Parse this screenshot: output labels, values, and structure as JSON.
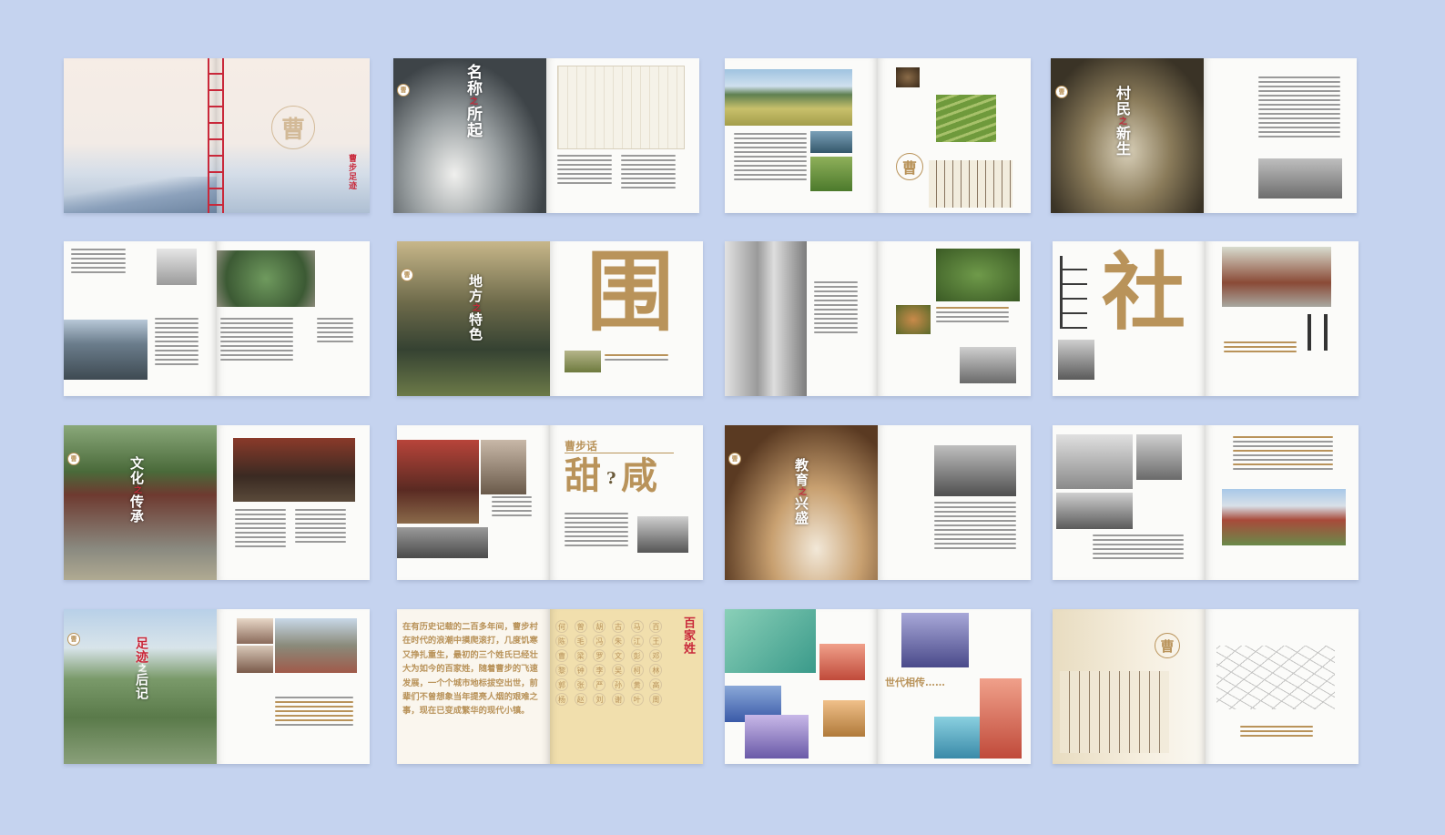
{
  "spreads": [
    {
      "id": 1,
      "title": "曹步足迹",
      "logo": "曹"
    },
    {
      "id": 2,
      "title_main": "名称",
      "title_join": "之",
      "title_end": "所起"
    },
    {
      "id": 3,
      "logo": "曹"
    },
    {
      "id": 4,
      "title_main": "村民",
      "title_join": "之",
      "title_end": "新生"
    },
    {
      "id": 5
    },
    {
      "id": 6,
      "title_main": "地方",
      "title_join": "之",
      "title_end": "特色",
      "big_char": "围"
    },
    {
      "id": 7
    },
    {
      "id": 8,
      "big_char": "社"
    },
    {
      "id": 9,
      "title_main": "文化",
      "title_join": "之",
      "title_end": "传承"
    },
    {
      "id": 10,
      "heading": "曹步话",
      "big_left": "甜",
      "big_mid": "?",
      "big_right": "咸"
    },
    {
      "id": 11,
      "title_main": "教育",
      "title_join": "之",
      "title_end": "兴盛"
    },
    {
      "id": 12
    },
    {
      "id": 13,
      "title_main": "足迹",
      "title_join": "之",
      "title_end": "后记"
    },
    {
      "id": 14,
      "heading": "百家姓",
      "body": "在有历史记载的二百多年间，曹步村在时代的浪潮中摸爬滚打，几度饥寒又挣扎重生，最初的三个姓氏已经壮大为如今的百家姓，随着曹步的飞速发展，一个个城市地标拔空出世，前辈们不曾想象当年提亮人烟的艰难之事，现在已变成繁华的现代小镇。",
      "surnames": [
        "何",
        "曾",
        "胡",
        "古",
        "马",
        "百",
        "陈",
        "毛",
        "冯",
        "朱",
        "江",
        "王",
        "曹",
        "梁",
        "罗",
        "文",
        "彭",
        "邓",
        "黎",
        "钟",
        "李",
        "吴",
        "柯",
        "林",
        "郭",
        "张",
        "严",
        "孙",
        "黄",
        "高",
        "杨",
        "赵",
        "刘",
        "谢",
        "叶",
        "周"
      ]
    },
    {
      "id": 15,
      "heading": "世代相传……"
    },
    {
      "id": 16,
      "logo": "曹"
    }
  ],
  "colors": {
    "background": "#c5d3ef",
    "gold": "#b9935a",
    "red": "#c9283a"
  }
}
